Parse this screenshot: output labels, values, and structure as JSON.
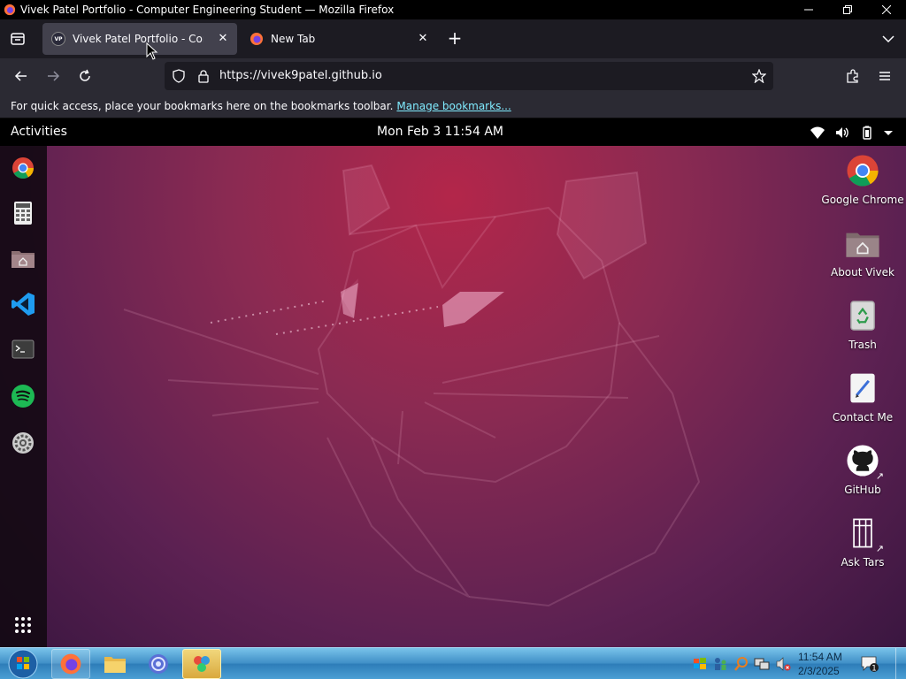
{
  "window": {
    "title": "Vivek Patel Portfolio - Computer Engineering Student — Mozilla Firefox",
    "controls": [
      "minimize-icon",
      "restore-icon",
      "close-icon"
    ]
  },
  "tabs": [
    {
      "title": "Vivek Patel Portfolio - Computer Engineering Student",
      "favicon_text": "VP",
      "active": true
    },
    {
      "title": "New Tab",
      "active": false
    }
  ],
  "navbar": {
    "url": "https://vivek9patel.github.io",
    "icons": [
      "back-icon",
      "forward-icon",
      "reload-icon",
      "shield-icon",
      "lock-icon",
      "star-icon",
      "extensions-icon",
      "menu-icon"
    ]
  },
  "bookmarks_bar": {
    "message": "For quick access, place your bookmarks here on the bookmarks toolbar.",
    "link": "Manage bookmarks..."
  },
  "topbar": {
    "activities": "Activities",
    "clock": "Mon Feb 3 11:54 AM",
    "icons": [
      "wifi-icon",
      "volume-icon",
      "battery-icon",
      "chevron-down-icon"
    ]
  },
  "dock": {
    "items": [
      "chrome-icon",
      "calculator-icon",
      "files-icon",
      "vscode-icon",
      "terminal-icon",
      "spotify-icon",
      "settings-icon",
      "app-grid-icon"
    ]
  },
  "desktop_icons": [
    {
      "label": "Google Chrome",
      "icon": "chrome-icon"
    },
    {
      "label": "About Vivek",
      "icon": "home-folder-icon"
    },
    {
      "label": "Trash",
      "icon": "trash-icon"
    },
    {
      "label": "Contact Me",
      "icon": "compose-icon"
    },
    {
      "label": "GitHub",
      "icon": "github-icon"
    },
    {
      "label": "Ask Tars",
      "icon": "tars-icon"
    }
  ],
  "taskbar": {
    "items": [
      "start-orb-icon",
      "firefox-icon",
      "file-explorer-icon",
      "app-icon",
      "paint-icon"
    ],
    "tray_icons": [
      "flag-icon",
      "network-users-icon",
      "search-tray-icon",
      "network-icon",
      "volume-muted-icon"
    ],
    "time": "11:54 AM",
    "date": "2/3/2025",
    "notification_count": "1",
    "colors": {
      "taskbar": "#3e8ec6",
      "active_item": "#d9a93d"
    }
  },
  "colors": {
    "wallpaper_top": "#b3264a",
    "wallpaper_bottom": "#3a1640",
    "link": "#80ebff",
    "tab_active": "#42414d"
  }
}
